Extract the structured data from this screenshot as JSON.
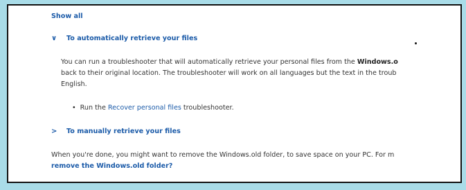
{
  "show_all": "Show all",
  "sections": [
    {
      "chevron": "∨",
      "title": "To automatically retrieve your files"
    },
    {
      "chevron": ">",
      "title": "To manually retrieve your files"
    }
  ],
  "auto_para": {
    "line1_pre": "You can run a troubleshooter that will automatically retrieve your personal files from the ",
    "line1_bold": "Windows.o",
    "line2": "back to their original location. The troubleshooter will work on all languages but the text in the troub",
    "line3": "English."
  },
  "bullet": {
    "symbol": "•",
    "pre": "Run the ",
    "link": "Recover personal files",
    "post": " troubleshooter."
  },
  "footer": {
    "line1": "When you're done, you might want to remove the Windows.old folder, to save space on your PC. For m",
    "line2_link": "remove the Windows.old folder?"
  }
}
